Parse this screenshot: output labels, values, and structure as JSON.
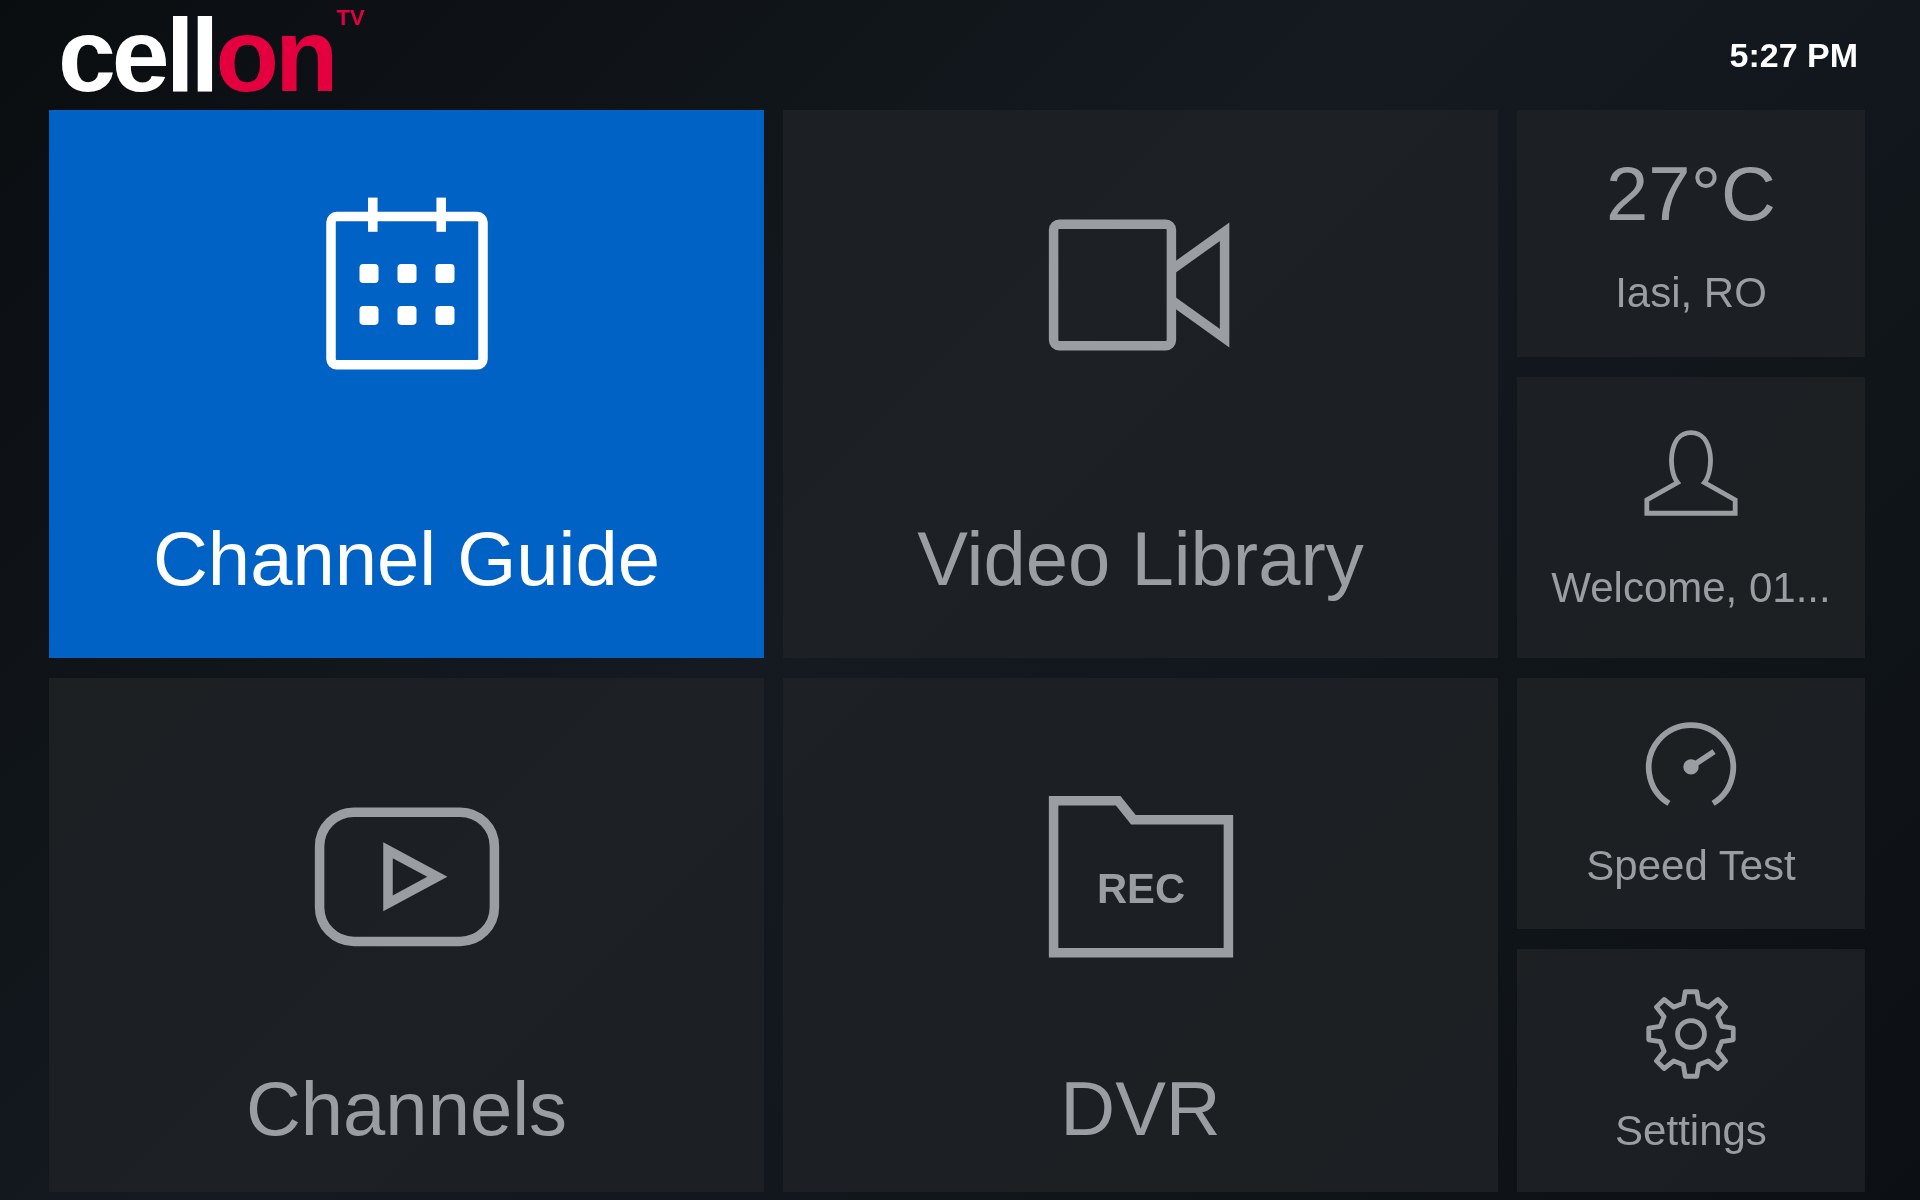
{
  "logo": {
    "part1": "cell",
    "part2": "on",
    "badge": "TV"
  },
  "clock": "5:27 PM",
  "rows": [
    {
      "tiles": [
        {
          "kind": "calendar",
          "label": "Channel Guide",
          "selected": true
        },
        {
          "kind": "camera",
          "label": "Video Library",
          "selected": false
        },
        {
          "kind": "weather",
          "temperature": "27°C",
          "location": "Iasi, RO",
          "selected": false
        },
        {
          "kind": "user",
          "label": "Welcome, 01...",
          "selected": false
        }
      ]
    },
    {
      "tiles": [
        {
          "kind": "play",
          "label": "Channels",
          "selected": false
        },
        {
          "kind": "rec",
          "label": "DVR",
          "icon_text": "REC",
          "selected": false
        },
        {
          "kind": "speed",
          "label": "Speed Test",
          "selected": false
        },
        {
          "kind": "settings",
          "label": "Settings",
          "selected": false
        }
      ]
    }
  ]
}
